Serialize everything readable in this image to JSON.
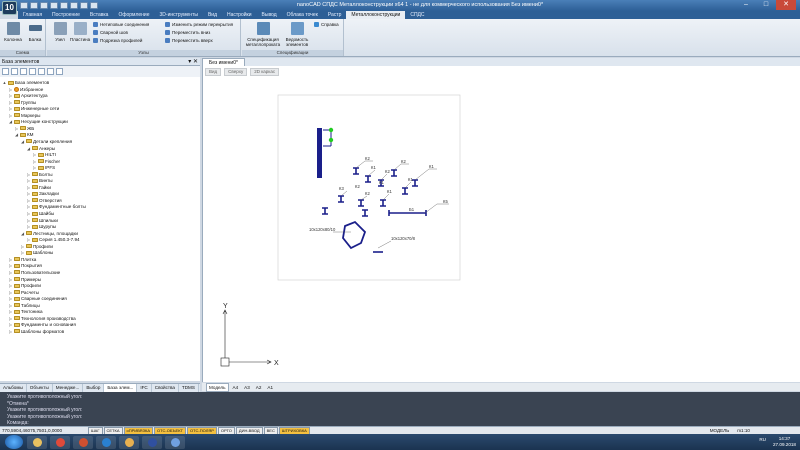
{
  "app": {
    "logo": "10",
    "title": "nanoCAD СПДС Металлоконструкции x64 1 - не для коммерческого использования Без имени0*"
  },
  "ribbon": {
    "tabs": [
      "Главная",
      "Построение",
      "Вставка",
      "Оформление",
      "3D-инструменты",
      "Вид",
      "Настройки",
      "Вывод",
      "Облака точек",
      "Растр",
      "Металлоконструкции",
      "СПДС"
    ],
    "active_tab": "Металлоконструкции",
    "groups": {
      "schema": {
        "label": "Схема",
        "buttons": [
          "Колонна",
          "Балка"
        ]
      },
      "nodes": {
        "label": "Узлы",
        "big": [
          "Узел",
          "Пластина"
        ],
        "small": [
          "Нетиповые соединения",
          "Сварной шов",
          "Подрезка профилей"
        ],
        "small2": [
          "Изменить режим перекрытия",
          "Переместить вниз",
          "Переместить вверх"
        ]
      },
      "spec": {
        "label": "Спецификации",
        "buttons": [
          "Спецификация металлопроката",
          "Ведомость элементов"
        ],
        "help": "Справка"
      }
    }
  },
  "left_panel": {
    "title": "База элементов",
    "tree": [
      {
        "label": "База элементов",
        "level": 0,
        "exp": "▲",
        "dot": false
      },
      {
        "label": "Избранное",
        "level": 1,
        "exp": "▷",
        "dot": true
      },
      {
        "label": "Архитектура",
        "level": 1,
        "exp": "▷",
        "dot": false
      },
      {
        "label": "Группы",
        "level": 1,
        "exp": "▷",
        "dot": false
      },
      {
        "label": "Инженерные сети",
        "level": 1,
        "exp": "▷",
        "dot": false
      },
      {
        "label": "Маркеры",
        "level": 1,
        "exp": "▷",
        "dot": false
      },
      {
        "label": "Несущие конструкции",
        "level": 1,
        "exp": "◢",
        "dot": false
      },
      {
        "label": "ЖБ",
        "level": 2,
        "exp": "▷",
        "dot": false
      },
      {
        "label": "КМ",
        "level": 2,
        "exp": "◢",
        "dot": false
      },
      {
        "label": "Детали крепления",
        "level": 3,
        "exp": "◢",
        "dot": false
      },
      {
        "label": "Анкеры",
        "level": 4,
        "exp": "◢",
        "dot": false
      },
      {
        "label": "HILTI",
        "level": 5,
        "exp": "▷",
        "dot": false
      },
      {
        "label": "Fischer",
        "level": 5,
        "exp": "▷",
        "dot": false
      },
      {
        "label": "IPFS",
        "level": 5,
        "exp": "▷",
        "dot": false
      },
      {
        "label": "Болты",
        "level": 4,
        "exp": "▷",
        "dot": false
      },
      {
        "label": "Винты",
        "level": 4,
        "exp": "▷",
        "dot": false
      },
      {
        "label": "Гайки",
        "level": 4,
        "exp": "▷",
        "dot": false
      },
      {
        "label": "Закладки",
        "level": 4,
        "exp": "▷",
        "dot": false
      },
      {
        "label": "Отверстия",
        "level": 4,
        "exp": "▷",
        "dot": false
      },
      {
        "label": "Фундаментные болты",
        "level": 4,
        "exp": "▷",
        "dot": false
      },
      {
        "label": "Шайбы",
        "level": 4,
        "exp": "▷",
        "dot": false
      },
      {
        "label": "Шпильки",
        "level": 4,
        "exp": "▷",
        "dot": false
      },
      {
        "label": "Шурупы",
        "level": 4,
        "exp": "▷",
        "dot": false
      },
      {
        "label": "Лестницы, площадки",
        "level": 3,
        "exp": "◢",
        "dot": false
      },
      {
        "label": "Серия 1.450.3-7.94",
        "level": 4,
        "exp": "▷",
        "dot": false
      },
      {
        "label": "Профили",
        "level": 3,
        "exp": "▷",
        "dot": false
      },
      {
        "label": "Шаблоны",
        "level": 3,
        "exp": "▷",
        "dot": false
      },
      {
        "label": "Плитка",
        "level": 1,
        "exp": "▷",
        "dot": false
      },
      {
        "label": "Покрытия",
        "level": 1,
        "exp": "▷",
        "dot": false
      },
      {
        "label": "Пользовательские",
        "level": 1,
        "exp": "▷",
        "dot": false
      },
      {
        "label": "Примеры",
        "level": 1,
        "exp": "▷",
        "dot": false
      },
      {
        "label": "Профили",
        "level": 1,
        "exp": "▷",
        "dot": false
      },
      {
        "label": "Расчеты",
        "level": 1,
        "exp": "▷",
        "dot": false
      },
      {
        "label": "Сварные соединения",
        "level": 1,
        "exp": "▷",
        "dot": false
      },
      {
        "label": "Таблицы",
        "level": 1,
        "exp": "▷",
        "dot": false
      },
      {
        "label": "Тектоника",
        "level": 1,
        "exp": "▷",
        "dot": false
      },
      {
        "label": "Технология производства",
        "level": 1,
        "exp": "▷",
        "dot": false
      },
      {
        "label": "Фундаменты и основания",
        "level": 1,
        "exp": "▷",
        "dot": false
      },
      {
        "label": "Шаблоны форматов",
        "level": 1,
        "exp": "▷",
        "dot": false
      }
    ],
    "bottom_tabs": [
      "Альбомы",
      "Объекты",
      "Менедже...",
      "Выбор",
      "База элем...",
      "IFC",
      "Свойства",
      "TDMS"
    ],
    "active_bottom_tab": "База элем..."
  },
  "document": {
    "tab": "Без имени0*",
    "breadcrumbs": [
      "Вид",
      "Сверху",
      "2D каркас"
    ],
    "model_tabs": [
      "Модель",
      "A4",
      "A3",
      "A2",
      "A1"
    ],
    "active_model_tab": "Модель",
    "labels": {
      "k2a": "К2",
      "k2b": "К2",
      "k1a": "К1",
      "k1b": "К1",
      "k2c": "К2",
      "k1c": "К1",
      "k3": "К3",
      "k2d": "К2",
      "k1d": "К1",
      "k2e": "К2",
      "k1e": "К1",
      "k5": "К5",
      "b1": "Б1",
      "plate1": "10x120x80/10",
      "plate2": "10x120x70/8"
    },
    "axis_y": "Y",
    "axis_x": "X"
  },
  "command_lines": [
    "Укажите противоположный угол:",
    "*Отмена*",
    "Укажите противоположный угол:",
    "Укажите противоположный угол:",
    "Команда:"
  ],
  "status": {
    "coords": "770,5904,46075,7501,0,0000",
    "toggles": [
      {
        "label": "ШАГ",
        "on": false
      },
      {
        "label": "СЕТКА",
        "on": false
      },
      {
        "label": "оПРИВЯЗКА",
        "on": true
      },
      {
        "label": "ОТС-ОБЪЕКТ",
        "on": true
      },
      {
        "label": "ОТС-ПОЛЯР",
        "on": true
      },
      {
        "label": "ОРТО",
        "on": false
      },
      {
        "label": "ДИН-ВВОД",
        "on": false
      },
      {
        "label": "ВЕС",
        "on": false
      },
      {
        "label": "ШТРИХОВКА",
        "on": true
      }
    ],
    "model_label": "МОДЕЛЬ",
    "scale": "m1:10"
  },
  "taskbar": {
    "apps": [
      "explorer",
      "chrome",
      "media",
      "ie",
      "folder",
      "nanocad",
      "app"
    ],
    "lang": "RU",
    "time": "14:37",
    "date": "27.09.2018"
  },
  "colors": {
    "drawing": "#1a1f8a",
    "grip": "#22cc22",
    "ribbon_bg": "#e3eaf2",
    "title_bg": "#2d5f96"
  }
}
